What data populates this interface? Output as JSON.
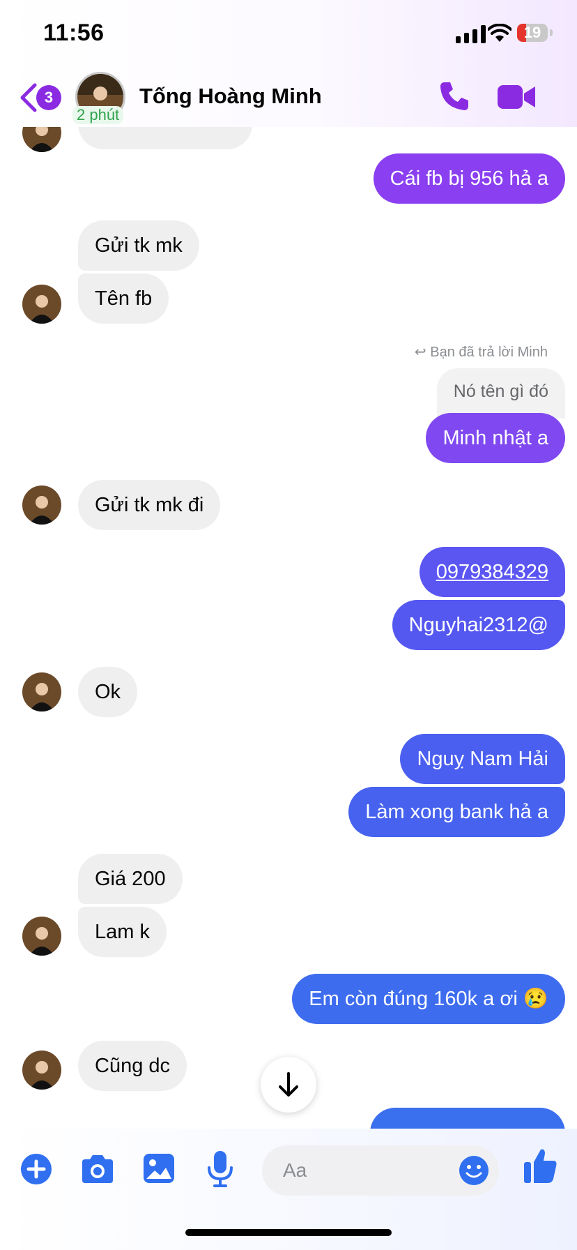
{
  "status_bar": {
    "time": "11:56",
    "battery": "19"
  },
  "header": {
    "back_badge": "3",
    "active_time": "2 phút",
    "contact_name": "Tống Hoàng Minh"
  },
  "messages": [
    {
      "text": "Cái fb bị 956 hả a"
    },
    {
      "text": "Gửi tk mk"
    },
    {
      "text": "Tên fb"
    },
    {
      "reply_note": "Bạn đã trả lời Minh",
      "quoted": "Nó tên gì đó",
      "text": "Minh nhật a"
    },
    {
      "text": "Gửi tk mk đi"
    },
    {
      "text": "0979384329"
    },
    {
      "text": "Nguyhai2312@"
    },
    {
      "text": "Ok"
    },
    {
      "text": "Nguỵ Nam Hải"
    },
    {
      "text": "Làm xong bank hả a"
    },
    {
      "text": "Giá 200"
    },
    {
      "text": "Lam k"
    },
    {
      "text": "Em còn đúng 160k a ơi 😢"
    },
    {
      "text": "Cũng dc"
    }
  ],
  "composer": {
    "placeholder": "Aa"
  },
  "colors": {
    "accent": "#8a2be2",
    "bubble_in": "#efefef",
    "blue": "#2f6ff0"
  }
}
